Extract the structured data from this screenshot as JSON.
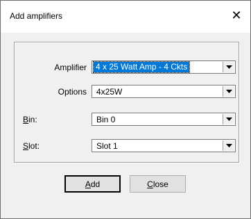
{
  "window": {
    "title": "Add amplifiers",
    "close_symbol": "✕"
  },
  "fields": [
    {
      "label": "Amplifier",
      "value": "4 x 25 Watt Amp - 4 Ckts"
    },
    {
      "label": "Options",
      "value": "4x25W"
    },
    {
      "label_first": "B",
      "label_rest": "in:",
      "value": "Bin 0"
    },
    {
      "label_first": "S",
      "label_rest": "lot:",
      "value": "Slot 1"
    }
  ],
  "buttons": {
    "add_first": "A",
    "add_rest": "dd",
    "close_first": "C",
    "close_rest": "lose"
  },
  "icons": {
    "close": "close-icon",
    "dropdown": "chevron-down-icon"
  },
  "colors": {
    "selection": "#0078d7",
    "dialog_bg": "#f0f0f0"
  }
}
